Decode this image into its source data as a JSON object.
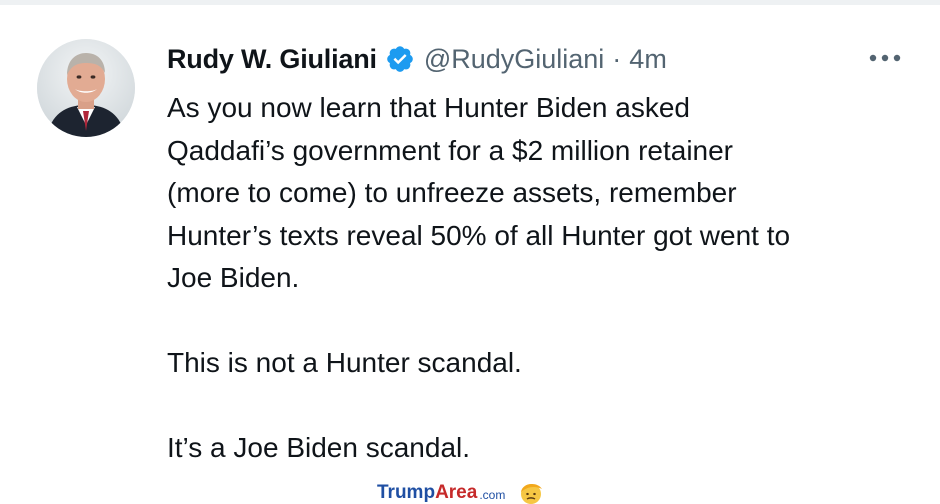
{
  "tweet": {
    "display_name": "Rudy W. Giuliani",
    "handle": "@RudyGiuliani",
    "separator": "·",
    "timestamp": "4m",
    "paragraphs": [
      [
        "As you now learn that Hunter Biden asked",
        "Qaddafi’s government for a $2 million retainer",
        "(more to come) to unfreeze assets, remember",
        "Hunter’s texts reveal 50% of all Hunter got went to",
        "Joe Biden."
      ],
      [
        "This is not a Hunter scandal."
      ],
      [
        "It’s a Joe Biden scandal."
      ]
    ]
  },
  "icons": {
    "verified": "verified-badge-icon",
    "more": "more-options-icon",
    "watermark_face": "trump-face-icon"
  },
  "watermark": {
    "brand_part1": "Trump",
    "brand_part2": "Area",
    "brand_suffix": ".com"
  },
  "colors": {
    "verified_blue": "#1d9bf0",
    "secondary_text": "#536471",
    "primary_text": "#0f1419",
    "watermark_blue": "#1f4fa3",
    "watermark_red": "#c62a2a"
  }
}
